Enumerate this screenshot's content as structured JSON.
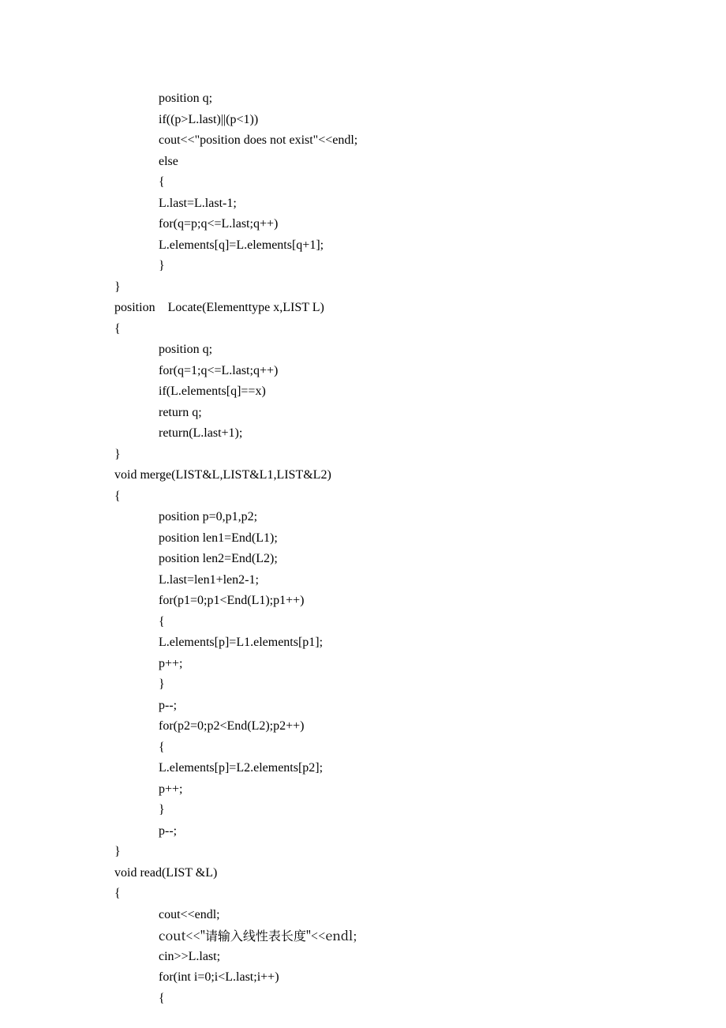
{
  "code": {
    "lines": [
      {
        "cls": "indent1",
        "text": "position q;"
      },
      {
        "cls": "indent1",
        "text": "if((p>L.last)||(p<1))"
      },
      {
        "cls": "indent1",
        "text": "cout<<\"position does not exist\"<<endl;"
      },
      {
        "cls": "indent1",
        "text": "else"
      },
      {
        "cls": "indent1",
        "text": "{"
      },
      {
        "cls": "indent1",
        "text": "L.last=L.last-1;"
      },
      {
        "cls": "indent1",
        "text": "for(q=p;q<=L.last;q++)"
      },
      {
        "cls": "indent1",
        "text": "L.elements[q]=L.elements[q+1];"
      },
      {
        "cls": "indent1",
        "text": "}"
      },
      {
        "cls": "indent0",
        "text": "}"
      },
      {
        "cls": "indent0",
        "text": "position    Locate(Elementtype x,LIST L)"
      },
      {
        "cls": "indent0",
        "text": "{"
      },
      {
        "cls": "indent1",
        "text": "position q;"
      },
      {
        "cls": "indent1",
        "text": "for(q=1;q<=L.last;q++)"
      },
      {
        "cls": "indent1",
        "text": "if(L.elements[q]==x)"
      },
      {
        "cls": "indent1",
        "text": "return q;"
      },
      {
        "cls": "indent1",
        "text": "return(L.last+1);"
      },
      {
        "cls": "indent0",
        "text": "}"
      },
      {
        "cls": "indent0",
        "text": "void merge(LIST&L,LIST&L1,LIST&L2)"
      },
      {
        "cls": "indent0",
        "text": "{"
      },
      {
        "cls": "indent1",
        "text": "position p=0,p1,p2;"
      },
      {
        "cls": "indent1",
        "text": "position len1=End(L1);"
      },
      {
        "cls": "indent1",
        "text": "position len2=End(L2);"
      },
      {
        "cls": "indent1",
        "text": "L.last=len1+len2-1;"
      },
      {
        "cls": "indent1",
        "text": "for(p1=0;p1<End(L1);p1++)"
      },
      {
        "cls": "indent1",
        "text": "{"
      },
      {
        "cls": "indent1",
        "text": "L.elements[p]=L1.elements[p1];"
      },
      {
        "cls": "indent1",
        "text": "p++;"
      },
      {
        "cls": "indent1",
        "text": "}"
      },
      {
        "cls": "indent1",
        "text": "p--;"
      },
      {
        "cls": "indent1",
        "text": "for(p2=0;p2<End(L2);p2++)"
      },
      {
        "cls": "indent1",
        "text": "{"
      },
      {
        "cls": "indent1",
        "text": "L.elements[p]=L2.elements[p2];"
      },
      {
        "cls": "indent1",
        "text": "p++;"
      },
      {
        "cls": "indent1",
        "text": "}"
      },
      {
        "cls": "indent1",
        "text": "p--;"
      },
      {
        "cls": "indent0",
        "text": "}"
      },
      {
        "cls": "indent0",
        "text": "void read(LIST &L)"
      },
      {
        "cls": "indent0",
        "text": "{"
      },
      {
        "cls": "indent1",
        "text": "cout<<endl;"
      },
      {
        "cls": "indent1",
        "text": "cout<<\"请输入线性表长度\"<<endl;",
        "cjk": true
      },
      {
        "cls": "indent1",
        "text": "cin>>L.last;"
      },
      {
        "cls": "indent1",
        "text": "for(int i=0;i<L.last;i++)"
      },
      {
        "cls": "indent1",
        "text": "{"
      }
    ]
  }
}
